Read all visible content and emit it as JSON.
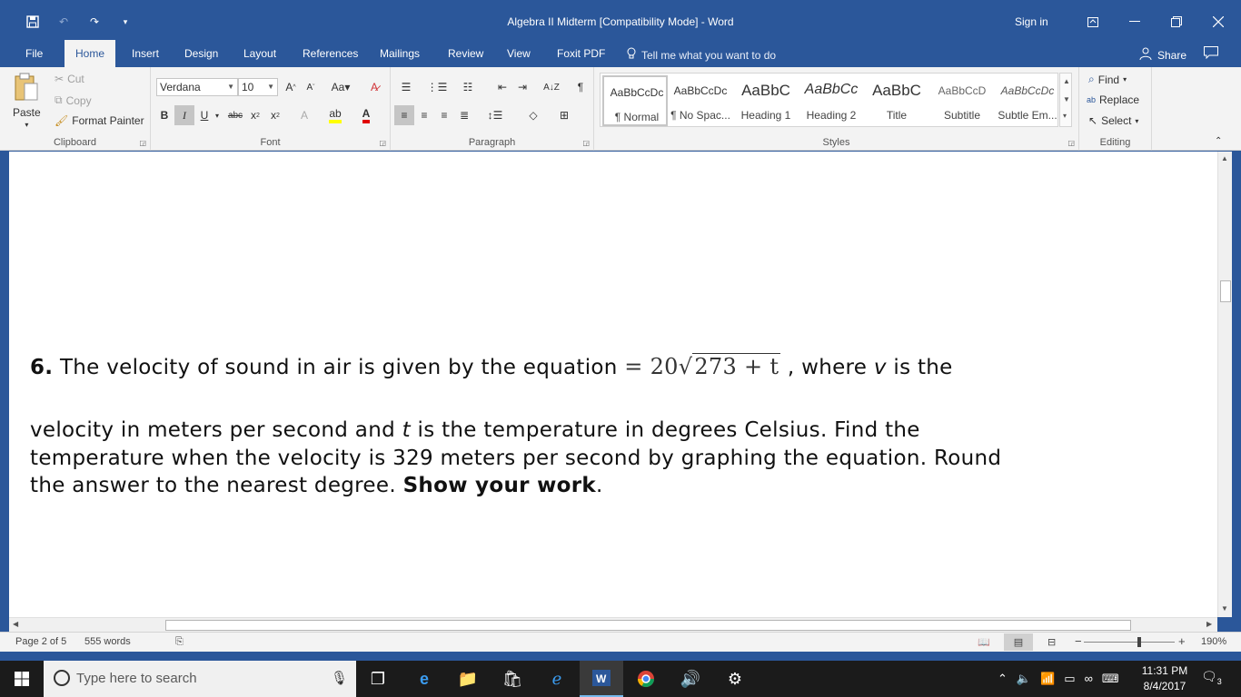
{
  "window": {
    "title": "Algebra II Midterm [Compatibility Mode]  -  Word",
    "sign_in": "Sign in"
  },
  "tabs": [
    "File",
    "Home",
    "Insert",
    "Design",
    "Layout",
    "References",
    "Mailings",
    "Review",
    "View",
    "Foxit PDF"
  ],
  "active_tab": "Home",
  "tell_me": "Tell me what you want to do",
  "share": "Share",
  "clipboard": {
    "paste": "Paste",
    "cut": "Cut",
    "copy": "Copy",
    "format_painter": "Format Painter",
    "label": "Clipboard"
  },
  "font": {
    "name": "Verdana",
    "size": "10",
    "label": "Font"
  },
  "paragraph": {
    "label": "Paragraph"
  },
  "styles": {
    "label": "Styles",
    "items": [
      {
        "sample": "AaBbCcDc",
        "name": "¶ Normal"
      },
      {
        "sample": "AaBbCcDc",
        "name": "¶ No Spac..."
      },
      {
        "sample": "AaBbC",
        "name": "Heading 1"
      },
      {
        "sample": "AaBbCc",
        "name": "Heading 2"
      },
      {
        "sample": "AaBbC",
        "name": "Title"
      },
      {
        "sample": "AaBbCcD",
        "name": "Subtitle"
      },
      {
        "sample": "AaBbCcDc",
        "name": "Subtle Em..."
      }
    ]
  },
  "editing": {
    "find": "Find",
    "replace": "Replace",
    "select": "Select",
    "label": "Editing"
  },
  "document": {
    "q_number": "6.",
    "line1_text": " The velocity of sound in air is given by the equation ",
    "eq_prefix": "= 20",
    "eq_radical": "√",
    "eq_radicand": "273 + t",
    "line1_after": " , where ",
    "var_v": "v",
    "line1_end": " is the",
    "line2_start": "velocity in meters per second and ",
    "var_t": "t",
    "line2_end": " is the temperature in degrees Celsius. Find the",
    "line3": "temperature when the velocity is 329 meters per second by graphing the equation. Round",
    "line4_start": "the answer to the nearest degree. ",
    "line4_bold": "Show your work",
    "line4_end": "."
  },
  "status": {
    "page": "Page 2 of 5",
    "words": "555 words",
    "zoom": "190%"
  },
  "taskbar": {
    "search_placeholder": "Type here to search",
    "time": "11:31 PM",
    "date": "8/4/2017",
    "notifications": "3"
  }
}
